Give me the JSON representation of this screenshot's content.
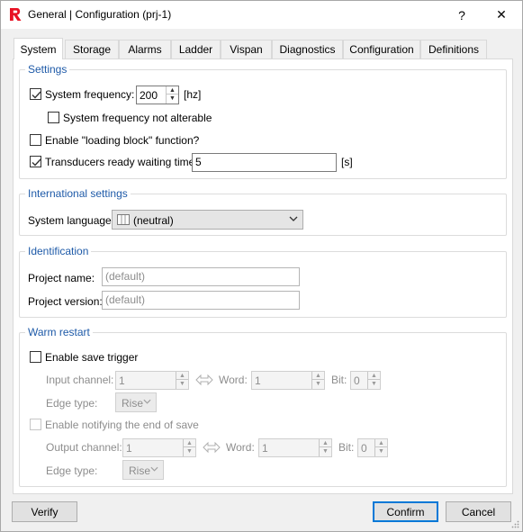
{
  "window": {
    "title": "General | Configuration (prj-1)",
    "help_label": "?",
    "close_label": "✕"
  },
  "tabs": [
    {
      "label": "System",
      "active": true
    },
    {
      "label": "Storage"
    },
    {
      "label": "Alarms"
    },
    {
      "label": "Ladder"
    },
    {
      "label": "Vispan"
    },
    {
      "label": "Diagnostics"
    },
    {
      "label": "Configuration"
    },
    {
      "label": "Definitions"
    }
  ],
  "settings": {
    "title": "Settings",
    "system_frequency": {
      "label": "System frequency:",
      "checked": true,
      "value": "200",
      "unit": "[hz]"
    },
    "not_alterable": {
      "label": "System frequency not alterable",
      "checked": false
    },
    "loading_block": {
      "label": "Enable \"loading block\" function?",
      "checked": false
    },
    "transducers": {
      "label": "Transducers ready waiting time:",
      "checked": true,
      "value": "5",
      "unit": "[s]"
    }
  },
  "international": {
    "title": "International settings",
    "language_label": "System language:",
    "language_value": "(neutral)"
  },
  "identification": {
    "title": "Identification",
    "project_name_label": "Project name:",
    "project_name_placeholder": "(default)",
    "project_version_label": "Project version:",
    "project_version_placeholder": "(default)"
  },
  "warm_restart": {
    "title": "Warm restart",
    "save_trigger": {
      "label": "Enable save trigger",
      "checked": false
    },
    "input_channel_label": "Input channel:",
    "input_channel_value": "1",
    "word_label": "Word:",
    "word_value": "1",
    "bit_label": "Bit:",
    "bit_value": "0",
    "edge_label": "Edge type:",
    "edge_value": "Rise",
    "notify": {
      "label": "Enable notifying the end of save",
      "checked": false
    },
    "output_channel_label": "Output channel:",
    "output_channel_value": "1",
    "word2_label": "Word:",
    "word2_value": "1",
    "bit2_label": "Bit:",
    "bit2_value": "0",
    "edge2_label": "Edge type:",
    "edge2_value": "Rise"
  },
  "footer": {
    "verify_label": "Verify",
    "confirm_label": "Confirm",
    "cancel_label": "Cancel"
  },
  "colors": {
    "group_title": "#1e5aa8",
    "accent": "#0078d7",
    "logo_red": "#e81123"
  },
  "icons": [
    "app-logo-icon",
    "help-icon",
    "close-icon",
    "checkmark-icon",
    "spin-up-icon",
    "spin-down-icon",
    "chevron-down-icon",
    "language-flag-icon",
    "link-arrows-icon",
    "resize-grip-icon"
  ]
}
